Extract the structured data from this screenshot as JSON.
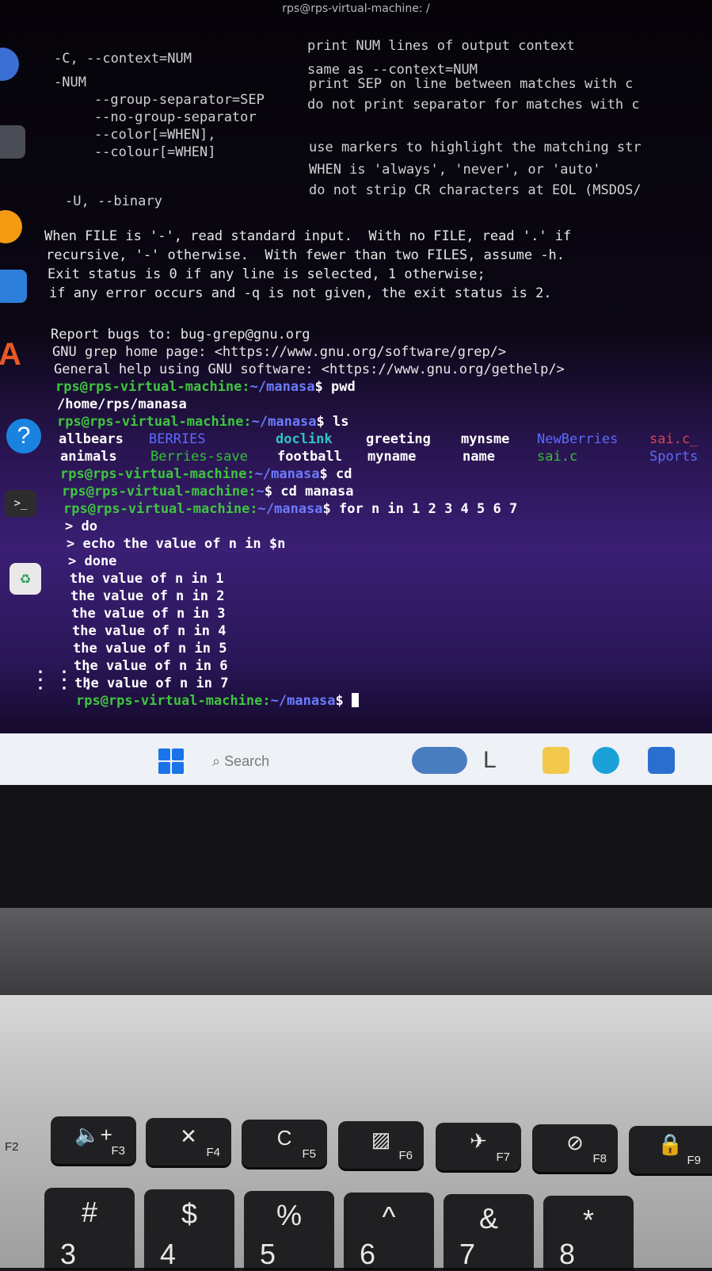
{
  "window": {
    "title": "rps@rps-virtual-machine: /"
  },
  "terminal": {
    "help_options": [
      {
        "opt": "-C, --context=NUM",
        "desc": "print NUM lines of output context"
      },
      {
        "opt": "-NUM",
        "desc": "same as --context=NUM"
      },
      {
        "opt": "    --group-separator=SEP",
        "desc": "print SEP on line between matches with c"
      },
      {
        "opt": "    --no-group-separator",
        "desc": "do not print separator for matches with c"
      },
      {
        "opt": "    --color[=WHEN],",
        "desc": ""
      },
      {
        "opt": "    --colour[=WHEN]",
        "desc": "use markers to highlight the matching str"
      },
      {
        "opt": "",
        "desc": "WHEN is 'always', 'never', or 'auto'"
      },
      {
        "opt": "-U, --binary",
        "desc": "do not strip CR characters at EOL (MSDOS/"
      }
    ],
    "help_text": [
      "When FILE is '-', read standard input.  With no FILE, read '.' if",
      "recursive, '-' otherwise.  With fewer than two FILES, assume -h.",
      "Exit status is 0 if any line is selected, 1 otherwise;",
      "if any error occurs and -q is not given, the exit status is 2."
    ],
    "report": [
      "Report bugs to: bug-grep@gnu.org",
      "GNU grep home page: <https://www.gnu.org/software/grep/>",
      "General help using GNU software: <https://www.gnu.org/gethelp/>"
    ],
    "prompt_host": "rps@rps-virtual-machine:",
    "path_manasa": "~/manasa",
    "path_home": "~",
    "cmd_pwd": " pwd",
    "pwd_out": "/home/rps/manasa",
    "cmd_ls": " ls",
    "ls_row1": [
      {
        "text": "allbears",
        "kind": "w"
      },
      {
        "text": "BERRIES",
        "kind": "b"
      },
      {
        "text": "doclink",
        "kind": "c"
      },
      {
        "text": "greeting",
        "kind": "w"
      },
      {
        "text": "mynsme",
        "kind": "w"
      },
      {
        "text": "NewBerries",
        "kind": "b"
      },
      {
        "text": "sai.c_",
        "kind": "r"
      }
    ],
    "ls_row2": [
      {
        "text": "animals",
        "kind": "w"
      },
      {
        "text": "Berries-save",
        "kind": "g"
      },
      {
        "text": "football",
        "kind": "w"
      },
      {
        "text": "myname",
        "kind": "w"
      },
      {
        "text": "name",
        "kind": "w"
      },
      {
        "text": "sai.c",
        "kind": "g"
      },
      {
        "text": "Sports",
        "kind": "b"
      }
    ],
    "cmd_cd": " cd",
    "cmd_cd_manasa": " cd manasa",
    "cmd_for": " for n in 1 2 3 4 5 6 7",
    "cont_do": "> do",
    "cont_echo": "> echo the value of n in $n",
    "cont_done": "> done",
    "output": [
      "the value of n in 1",
      "the value of n in 2",
      "the value of n in 3",
      "the value of n in 4",
      "the value of n in 5",
      "the value of n in 6",
      "the value of n in 7"
    ],
    "dollar": "$"
  },
  "taskbar": {
    "search_placeholder": "Search"
  },
  "keyboard": {
    "fkeys": [
      {
        "icon": "volume-up-icon",
        "glyph": "🔈+",
        "label": "F3"
      },
      {
        "icon": "mic-mute-icon",
        "glyph": "✕",
        "label": "F4"
      },
      {
        "icon": "refresh-icon",
        "glyph": "C",
        "label": "F5"
      },
      {
        "icon": "screen-icon",
        "glyph": "▨",
        "label": "F6"
      },
      {
        "icon": "airplane-icon",
        "glyph": "✈",
        "label": "F7"
      },
      {
        "icon": "camera-off-icon",
        "glyph": "⊘",
        "label": "F8"
      },
      {
        "icon": "lock-icon",
        "glyph": "🔒",
        "label": "F9"
      }
    ],
    "side_left": "F2",
    "num_keys": [
      {
        "top": "#",
        "bottom": "3"
      },
      {
        "top": "$",
        "bottom": "4"
      },
      {
        "top": "%",
        "bottom": "5"
      },
      {
        "top": "^",
        "bottom": "6"
      },
      {
        "top": "&",
        "bottom": "7"
      },
      {
        "top": "*",
        "bottom": "8"
      }
    ]
  }
}
